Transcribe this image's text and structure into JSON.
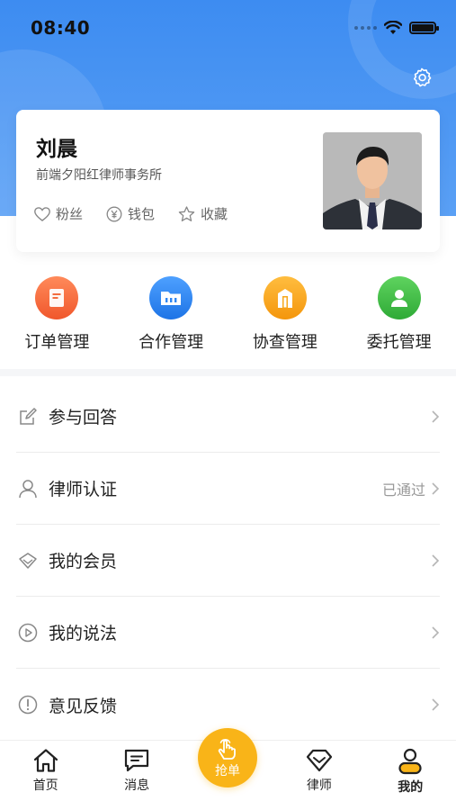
{
  "statusbar": {
    "time": "08:40"
  },
  "profile": {
    "name": "刘晨",
    "firm": "前端夕阳红律师事务所",
    "stats": [
      {
        "label": "粉丝",
        "icon": "heart-icon"
      },
      {
        "label": "钱包",
        "icon": "yen-icon"
      },
      {
        "label": "收藏",
        "icon": "star-icon"
      }
    ]
  },
  "quick_actions": [
    {
      "label": "订单管理",
      "icon": "order-icon",
      "color": "#f36d3f"
    },
    {
      "label": "合作管理",
      "icon": "folder-icon",
      "color": "#2f86f2"
    },
    {
      "label": "协查管理",
      "icon": "building-icon",
      "color": "#f7a81b"
    },
    {
      "label": "委托管理",
      "icon": "person-icon",
      "color": "#45c24a"
    }
  ],
  "menu": [
    {
      "label": "参与回答",
      "icon": "edit-icon",
      "value": ""
    },
    {
      "label": "律师认证",
      "icon": "user-icon",
      "value": "已通过"
    },
    {
      "label": "我的会员",
      "icon": "gem-icon",
      "value": ""
    },
    {
      "label": "我的说法",
      "icon": "play-circle-icon",
      "value": ""
    },
    {
      "label": "意见反馈",
      "icon": "alert-icon",
      "value": ""
    }
  ],
  "tabbar": {
    "home": "首页",
    "messages": "消息",
    "grab": "抢单",
    "lawyers": "律师",
    "mine": "我的"
  },
  "colors": {
    "primary": "#3d8cf1",
    "accent": "#f9b418"
  }
}
